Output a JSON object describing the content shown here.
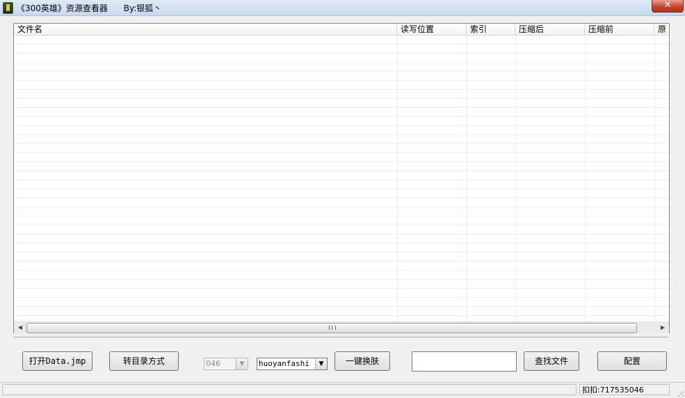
{
  "window": {
    "title": "《300英雄》资源查看器      By:银狐丶",
    "close_glyph": "✕"
  },
  "list": {
    "columns": [
      "文件名",
      "读写位置",
      "索引",
      "压缩后",
      "压缩前",
      "原"
    ],
    "rows": []
  },
  "toolbar": {
    "open_button": "打开Data.jmp",
    "dir_mode_button": "转目录方式",
    "number_combo": {
      "value": "046",
      "enabled": false
    },
    "skin_combo": {
      "value": "huoyanfashi"
    },
    "skin_button": "一键换肤",
    "search_input": {
      "value": ""
    },
    "search_button": "查找文件",
    "config_button": "配置"
  },
  "statusbar": {
    "qq": "扣扣:717535046"
  },
  "scrollbar": {
    "thumb_glyph": "III"
  }
}
